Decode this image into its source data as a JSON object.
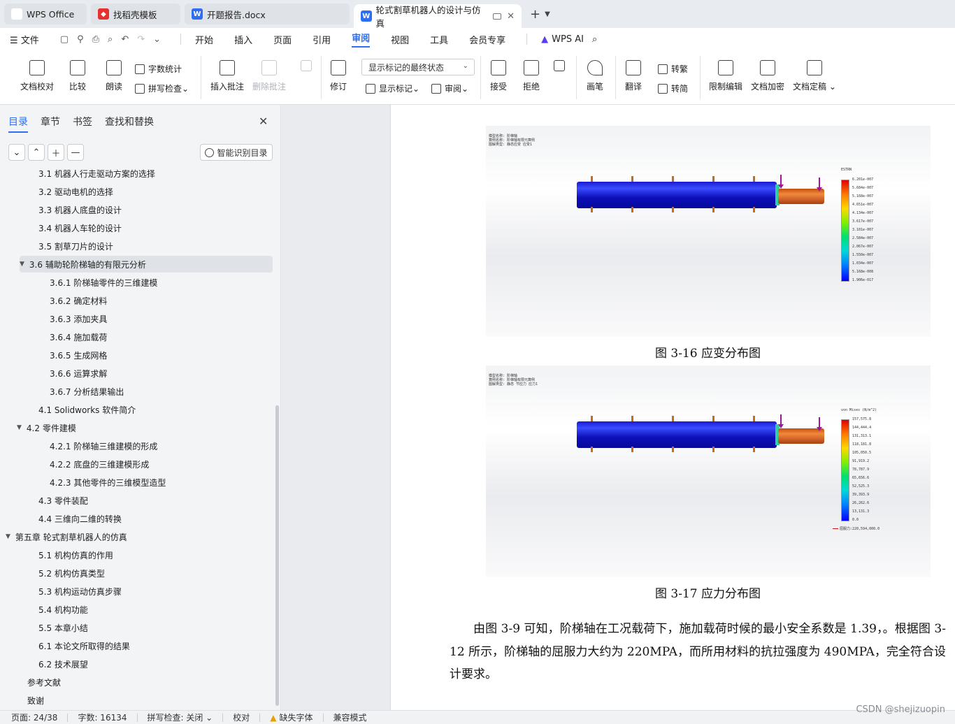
{
  "tabs": [
    {
      "label": "WPS Office",
      "icon": "wps-logo-icon"
    },
    {
      "label": "找稻壳模板",
      "icon": "template-icon"
    },
    {
      "label": "开题报告.docx",
      "icon": "word-doc-icon"
    },
    {
      "label": "轮式割草机器人的设计与仿真",
      "icon": "word-doc-icon",
      "active": true
    }
  ],
  "menu": {
    "file": "文件",
    "items": [
      "开始",
      "插入",
      "页面",
      "引用",
      "审阅",
      "视图",
      "工具",
      "会员专享"
    ],
    "active": "审阅",
    "ai": "WPS AI"
  },
  "ribbon": {
    "doc_check": "文档校对",
    "compare": "比较",
    "read_aloud": "朗读",
    "word_count": "字数统计",
    "spell_check": "拼写检查",
    "insert_comment": "插入批注",
    "delete_comment": "删除批注",
    "track": "修订",
    "markup_select": "显示标记的最终状态",
    "show_markup": "显示标记",
    "review": "审阅",
    "accept": "接受",
    "reject": "拒绝",
    "pen": "画笔",
    "translate": "翻译",
    "to_traditional": "转繁",
    "to_simplified": "转简",
    "restrict_edit": "限制编辑",
    "encrypt": "文档加密",
    "finalize": "文档定稿"
  },
  "sidebar": {
    "tabs": [
      "目录",
      "章节",
      "书签",
      "查找和替换"
    ],
    "active_tab": "目录",
    "smart_toc": "智能识别目录",
    "toc": [
      {
        "label": "3.1 机器人行走驱动方案的选择",
        "level": 2
      },
      {
        "label": "3.2 驱动电机的选择",
        "level": 2
      },
      {
        "label": "3.3 机器人底盘的设计",
        "level": 2
      },
      {
        "label": "3.4  机器人车轮的设计",
        "level": 2
      },
      {
        "label": "3.5 割草刀片的设计",
        "level": 2
      },
      {
        "label": "3.6  辅助轮阶梯轴的有限元分析",
        "level": 2,
        "expanded": true,
        "selected": true
      },
      {
        "label": "3.6.1  阶梯轴零件的三维建模",
        "level": 3
      },
      {
        "label": "3.6.2  确定材料",
        "level": 3
      },
      {
        "label": "3.6.3  添加夹具",
        "level": 3
      },
      {
        "label": "3.6.4  施加载荷",
        "level": 3
      },
      {
        "label": "3.6.5  生成网格",
        "level": 3
      },
      {
        "label": "3.6.6  运算求解",
        "level": 3
      },
      {
        "label": "3.6.7  分析结果输出",
        "level": 3
      },
      {
        "label": "4.1 Solidworks 软件简介",
        "level": 2
      },
      {
        "label": "4.2  零件建模",
        "level": 2,
        "expanded": true
      },
      {
        "label": "4.2.1 阶梯轴三维建模的形成",
        "level": 3
      },
      {
        "label": "4.2.2  底盘的三维建模形成",
        "level": 3
      },
      {
        "label": "4.2.3 其他零件的三维模型造型",
        "level": 3
      },
      {
        "label": "4.3 零件装配",
        "level": 2
      },
      {
        "label": "4.4 三维向二维的转换",
        "level": 2
      },
      {
        "label": "第五章  轮式割草机器人的仿真",
        "level": 1,
        "expanded": true
      },
      {
        "label": "5.1 机构仿真的作用",
        "level": 2
      },
      {
        "label": "5.2 机构仿真类型",
        "level": 2
      },
      {
        "label": "5.3 机构运动仿真步骤",
        "level": 2
      },
      {
        "label": "5.4  机构功能",
        "level": 2
      },
      {
        "label": "5.5  本章小结",
        "level": 2
      },
      {
        "label": "6.1  本论文所取得的结果",
        "level": 2
      },
      {
        "label": "6.2  技术展望",
        "level": 2
      },
      {
        "label": "参考文献",
        "level": 1
      },
      {
        "label": "致谢",
        "level": 1
      }
    ]
  },
  "document": {
    "fig1": {
      "meta": [
        "模型名称: 阶梯轴",
        "算例名称: 阶梯轴有限元算例",
        "图解类型: 静态应变 应变1"
      ],
      "legend_title": "ESTRN",
      "legend_labels": [
        "6.201e-007",
        "5.684e-007",
        "5.168e-007",
        "4.651e-007",
        "4.134e-007",
        "3.617e-007",
        "3.101e-007",
        "2.584e-007",
        "2.067e-007",
        "1.550e-007",
        "1.034e-007",
        "5.168e-008",
        "1.906e-017"
      ],
      "caption": "图 3-16  应变分布图"
    },
    "fig2": {
      "meta": [
        "模型名称: 阶梯轴",
        "算例名称: 阶梯轴有限元算例",
        "图解类型: 静态 节应力 应力1"
      ],
      "legend_title": "von Mises (N/m^2)",
      "legend_labels": [
        "157,575.8",
        "144,444.4",
        "131,313.1",
        "118,181.8",
        "105,050.5",
        "91,919.2",
        "78,787.9",
        "65,656.6",
        "52,525.3",
        "39,393.9",
        "26,262.6",
        "13,131.3",
        "0.0"
      ],
      "yield": "屈服力:220,594,000.0",
      "caption": "图 3-17  应力分布图"
    },
    "paragraph": "由图 3-9 可知，阶梯轴在工况载荷下，施加载荷时候的最小安全系数是 1.39，。根据图 3-12 所示，阶梯轴的屈服力大约为 220MPA，而所用材料的抗拉强度为 490MPA，完全符合设计要求。"
  },
  "status": {
    "page": "页面: 24/38",
    "words": "字数: 16134",
    "spell": "拼写检查: 关闭",
    "proof": "校对",
    "missing_font": "缺失字体",
    "compat": "兼容模式"
  },
  "watermark": "CSDN @shejizuopin",
  "colors": {
    "accent": "#2d6ff0",
    "wps_red": "#e5322d"
  }
}
